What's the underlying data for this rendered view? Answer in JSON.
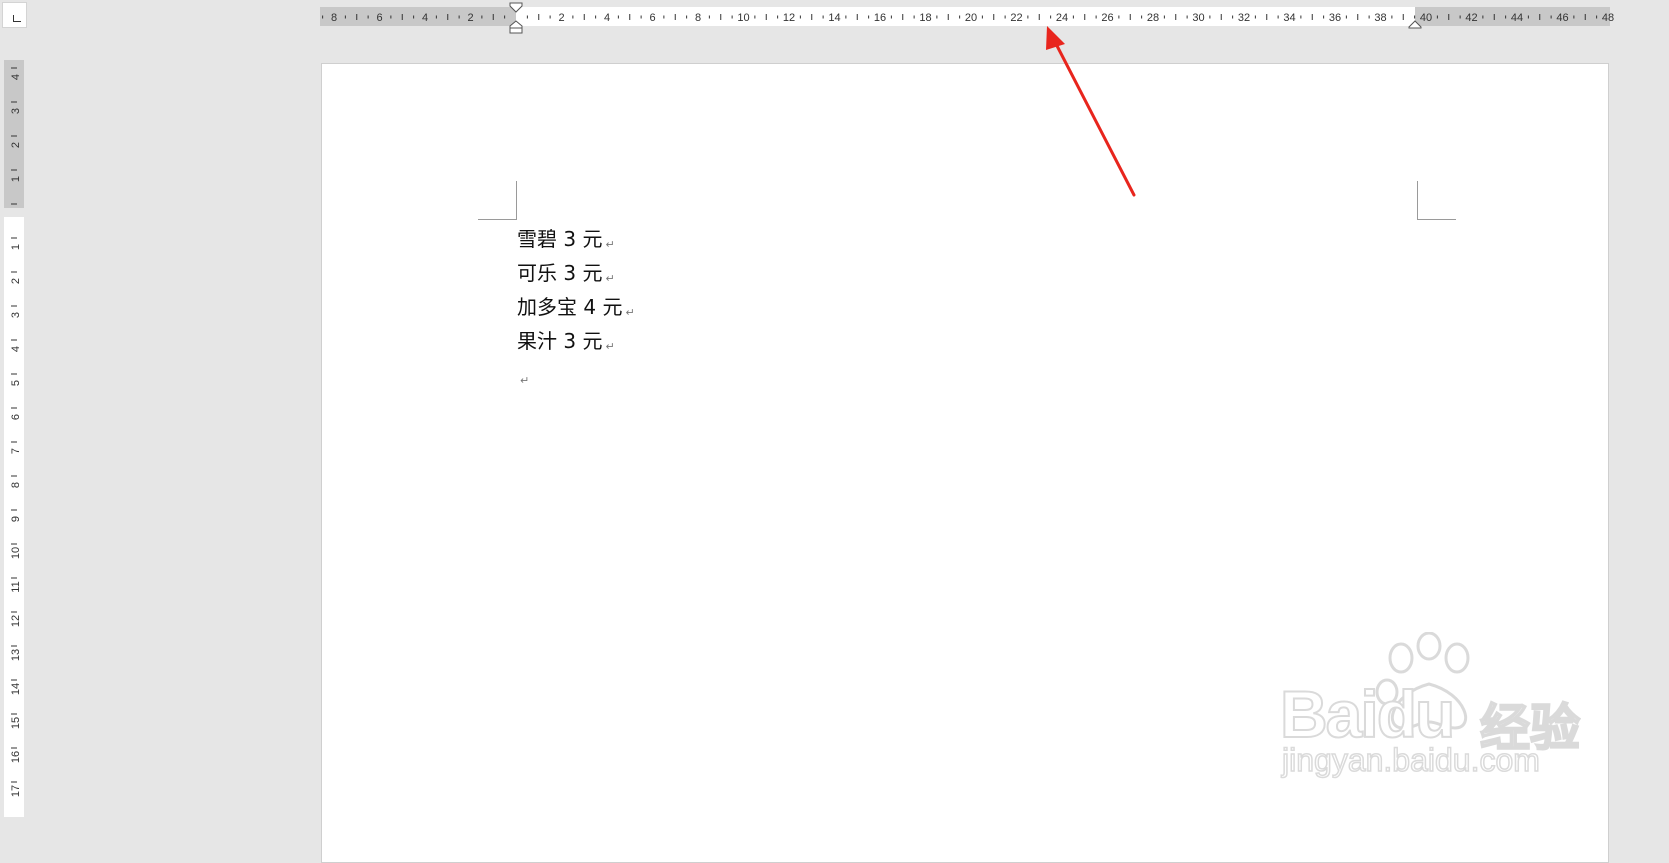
{
  "ruler": {
    "horizontal_labels": [
      "8",
      "6",
      "4",
      "2",
      "2",
      "4",
      "6",
      "8",
      "10",
      "12",
      "14",
      "16",
      "18",
      "20",
      "22",
      "24",
      "26",
      "28",
      "30",
      "32",
      "34",
      "36",
      "38",
      "40",
      "42",
      "44",
      "46",
      "48"
    ],
    "vertical_top_labels": [
      "4",
      "3",
      "2",
      "1"
    ],
    "vertical_labels": [
      "1",
      "2",
      "3",
      "4",
      "5",
      "6",
      "7",
      "8",
      "9",
      "10",
      "11",
      "12",
      "13",
      "14",
      "15",
      "16",
      "17"
    ]
  },
  "document": {
    "lines": [
      "雪碧 3 元",
      "可乐 3 元",
      "加多宝 4 元",
      "果汁 3 元",
      ""
    ],
    "paragraph_mark": "↵"
  },
  "annotation": {
    "arrow_color": "#e8251d"
  },
  "watermark": {
    "brand": "Baidu",
    "jingyan": "经验",
    "url": "jingyan.baidu.com"
  },
  "colors": {
    "workspace": "#e6e6e6",
    "ruler_active": "#ffffff",
    "ruler_margin": "#c8c8c8",
    "page": "#ffffff"
  }
}
